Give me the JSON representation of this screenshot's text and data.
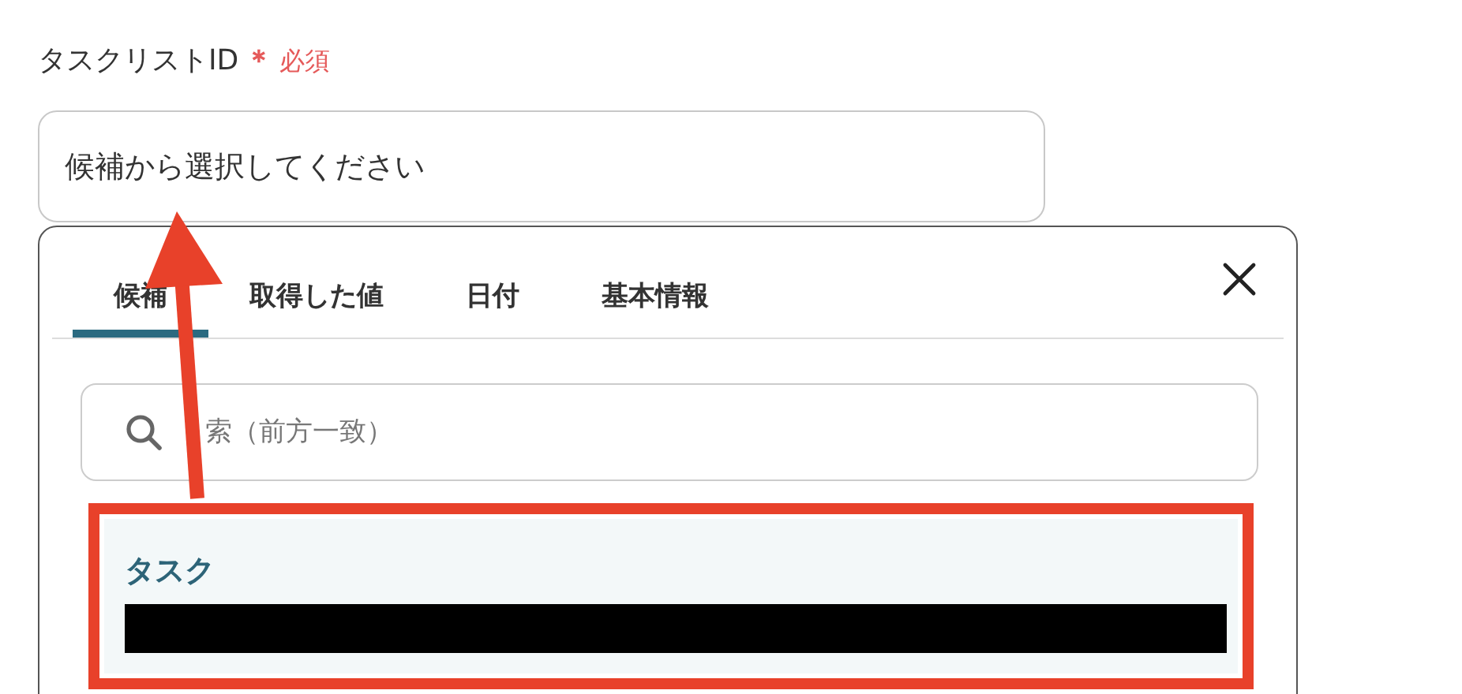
{
  "field": {
    "label": "タスクリストID",
    "required_mark": "＊",
    "required_text": "必須",
    "placeholder": "候補から選択してください"
  },
  "dropdown": {
    "tabs": [
      {
        "label": "候補",
        "selected": true
      },
      {
        "label": "取得した値",
        "selected": false
      },
      {
        "label": "日付",
        "selected": false
      },
      {
        "label": "基本情報",
        "selected": false
      }
    ],
    "search": {
      "placeholder": "索（前方一致）"
    },
    "options": [
      {
        "label": "タスク",
        "redacted": true,
        "highlighted": true
      }
    ]
  },
  "annotation": {
    "kind": "arrow"
  }
}
